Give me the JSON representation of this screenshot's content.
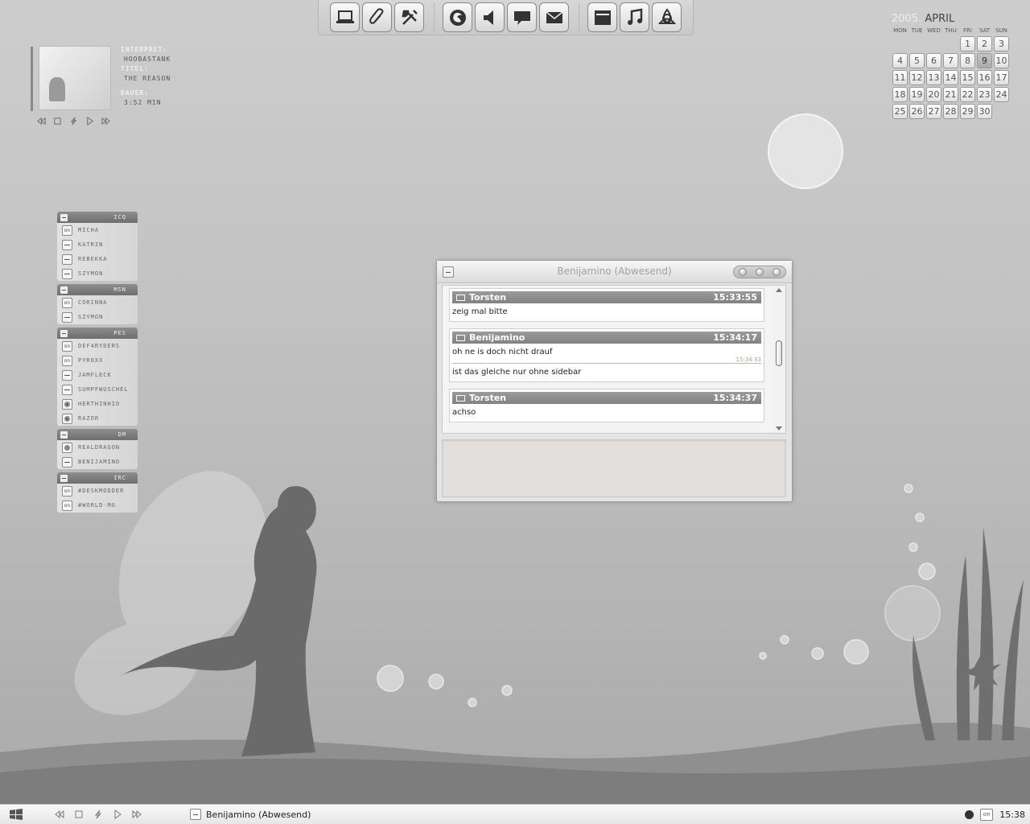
{
  "launcher": {
    "groups": [
      [
        {
          "icon": "laptop-icon"
        },
        {
          "icon": "paperclip-icon"
        },
        {
          "icon": "tools-icon"
        }
      ],
      [
        {
          "icon": "firefox-icon"
        },
        {
          "icon": "speaker-icon"
        },
        {
          "icon": "chat-bubble-icon"
        },
        {
          "icon": "mail-icon"
        }
      ],
      [
        {
          "icon": "window-icon"
        },
        {
          "icon": "music-note-icon"
        },
        {
          "icon": "trinity-icon"
        }
      ]
    ]
  },
  "media": {
    "interpret_label": "INTERPRET:",
    "interpret": "HOOBASTANK",
    "title_label": "TITEL:",
    "title": "THE REASON",
    "duration_label": "DAUER:",
    "duration": "3:52 MIN"
  },
  "calendar": {
    "year": "2005.",
    "month": "APRIL",
    "weekdays": [
      "MON",
      "TUE",
      "WED",
      "THU",
      "FRI",
      "SAT",
      "SUN"
    ],
    "leading_blanks": 4,
    "days": [
      "1",
      "2",
      "3",
      "4",
      "5",
      "6",
      "7",
      "8",
      "9",
      "10",
      "11",
      "12",
      "13",
      "14",
      "15",
      "16",
      "17",
      "18",
      "19",
      "20",
      "21",
      "22",
      "23",
      "24",
      "25",
      "26",
      "27",
      "28",
      "29",
      "30"
    ],
    "today": "9"
  },
  "contacts": [
    {
      "name": "ICQ",
      "items": [
        {
          "name": "MICHA",
          "status": "on"
        },
        {
          "name": "KATRIN",
          "status": "away"
        },
        {
          "name": "REBEKKA",
          "status": "away"
        },
        {
          "name": "SZYMON",
          "status": "away"
        }
      ]
    },
    {
      "name": "MSN",
      "items": [
        {
          "name": "CORINNA",
          "status": "on"
        },
        {
          "name": "SZYMON",
          "status": "away"
        }
      ]
    },
    {
      "name": "PES",
      "items": [
        {
          "name": "DEF4RYDERS",
          "status": "on"
        },
        {
          "name": "PYROXX",
          "status": "on"
        },
        {
          "name": "JAMFLECK",
          "status": "away"
        },
        {
          "name": "SUMPFWUSCHEL",
          "status": "away"
        },
        {
          "name": "HERTHINHIO",
          "status": "clock"
        },
        {
          "name": "RAZOR",
          "status": "clock"
        }
      ]
    },
    {
      "name": "DM",
      "items": [
        {
          "name": "REALDRAGON",
          "status": "dot"
        },
        {
          "name": "BENIJAMINO",
          "status": "away"
        }
      ]
    },
    {
      "name": "IRC",
      "items": [
        {
          "name": "#DESKMODDER",
          "status": "on"
        },
        {
          "name": "#WORLD-MG",
          "status": "on"
        }
      ]
    }
  ],
  "chat": {
    "title": "Benijamino (Abwesend)",
    "messages": [
      {
        "from": "Torsten",
        "time": "15:33:55",
        "lines": [
          "zeig mal bitte"
        ]
      },
      {
        "from": "Benijamino",
        "time": "15:34:17",
        "lines": [
          "oh ne is doch nicht drauf",
          "ist das gleiche nur ohne sidebar"
        ],
        "sub_time": "15:34:33"
      },
      {
        "from": "Torsten",
        "time": "15:34:37",
        "lines": [
          "achso"
        ]
      }
    ],
    "input_value": ""
  },
  "taskbar": {
    "task_label": "Benijamino (Abwesend)",
    "tray_on": "on",
    "clock": "15:38"
  },
  "status_on_text": "on"
}
